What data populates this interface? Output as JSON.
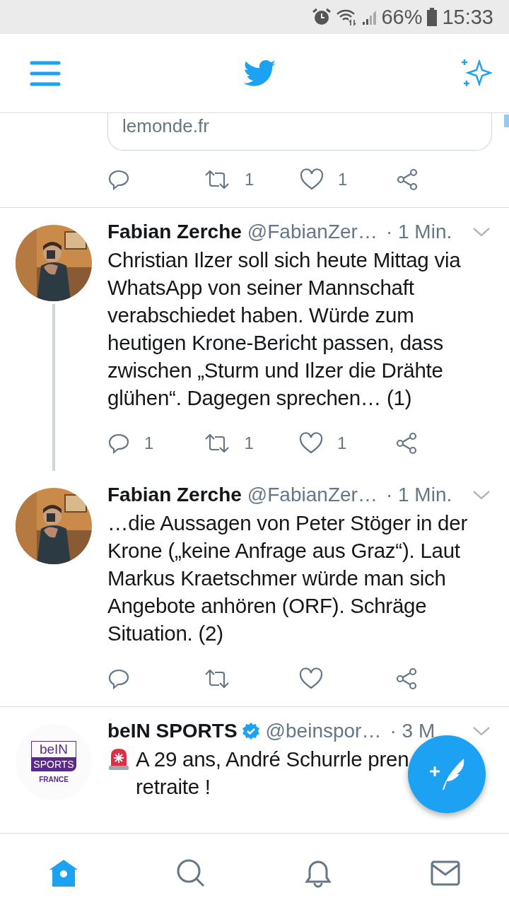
{
  "status_bar": {
    "battery": "66%",
    "time": "15:33"
  },
  "partial_tweet": {
    "link_domain": "lemonde.fr",
    "actions": {
      "retweet": "1",
      "like": "1"
    }
  },
  "tweets": [
    {
      "name": "Fabian Zerche",
      "verified": false,
      "handle": "@FabianZer…",
      "time": "· 1 Min.",
      "thread_below": true,
      "body": "Christian Ilzer soll sich heute Mittag via WhatsApp von seiner Mannschaft verabschiedet haben. Würde zum heutigen Krone-Bericht passen, dass zwischen „Sturm und Ilzer die Drähte glühen“. Dagegen sprechen… (1)",
      "actions": {
        "reply": "1",
        "retweet": "1",
        "like": "1"
      }
    },
    {
      "name": "Fabian Zerche",
      "verified": false,
      "handle": "@FabianZer…",
      "time": "· 1 Min.",
      "thread_below": false,
      "body": "…die Aussagen von Peter Stöger in der Krone („keine Anfrage aus Graz“). Laut Markus Kraetschmer würde man sich Angebote anhören (ORF). Schräge Situation. (2)"
    },
    {
      "kind": "logo",
      "logo_text": [
        "beIN",
        "SPORTS",
        "FRANCE"
      ],
      "name": "beIN SPORTS",
      "verified": true,
      "handle": "@beinspor…",
      "time": "· 3 M",
      "thread_below": false,
      "siren": true,
      "show_actions": false,
      "body": "A 29 ans, André Schurrle pren\nretraite !"
    }
  ],
  "bottom_nav": [
    {
      "kind": "home",
      "selected": true
    },
    {
      "kind": "search",
      "selected": false
    },
    {
      "kind": "notifications",
      "selected": false
    },
    {
      "kind": "messages",
      "selected": false
    }
  ]
}
